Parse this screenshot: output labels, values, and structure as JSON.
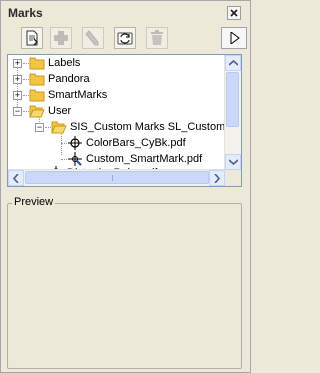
{
  "panel": {
    "title": "Marks"
  },
  "toolbar": {
    "buttons": [
      {
        "name": "import-button",
        "icon": "import-document-icon"
      },
      {
        "name": "add-button",
        "icon": "add-icon"
      },
      {
        "name": "edit-button",
        "icon": "edit-icon"
      },
      {
        "name": "refresh-button",
        "icon": "refresh-icon"
      },
      {
        "name": "delete-button",
        "icon": "trash-icon"
      },
      {
        "name": "expand-button",
        "icon": "triangle-right-icon"
      }
    ]
  },
  "tree": {
    "items": [
      {
        "label": "Labels",
        "type": "folder",
        "expanded": false
      },
      {
        "label": "Pandora",
        "type": "folder",
        "expanded": false
      },
      {
        "label": "SmartMarks",
        "type": "folder",
        "expanded": false
      },
      {
        "label": "User",
        "type": "folder",
        "expanded": true
      },
      {
        "label": "SIS_Custom Marks SL_Custom M",
        "type": "folder",
        "expanded": true
      },
      {
        "label": "ColorBars_CyBk.pdf",
        "type": "mark",
        "icon": "crosshair-icon"
      },
      {
        "label": "Custom_SmartMark.pdf",
        "type": "mark",
        "icon": "smartmark-icon"
      },
      {
        "label": "DistortionRuler.pdf",
        "type": "mark",
        "icon": "crosshair-icon"
      }
    ]
  },
  "preview": {
    "label": "Preview"
  },
  "colors": {
    "background": "#ece9d8",
    "scrollbar": "#c9d8fc",
    "folder": "#f4c542",
    "tree_border": "#7f9db9"
  }
}
